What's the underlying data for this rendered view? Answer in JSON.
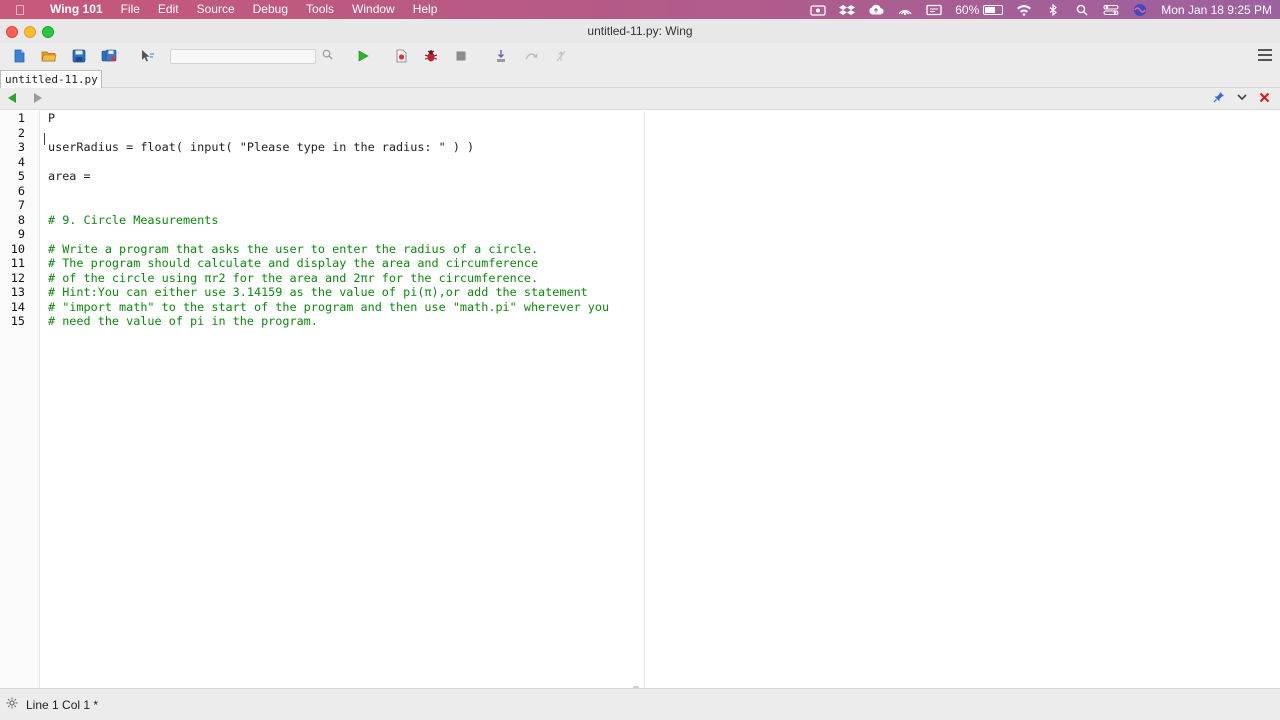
{
  "menubar": {
    "app_name": "Wing 101",
    "items": [
      "File",
      "Edit",
      "Source",
      "Debug",
      "Tools",
      "Window",
      "Help"
    ],
    "battery_percent": "60%",
    "battery_level": 0.6,
    "datetime": "Mon Jan 18  9:25 PM"
  },
  "window": {
    "title": "untitled-11.py: Wing"
  },
  "toolbar": {
    "search_value": "",
    "icons": [
      "new-file-icon",
      "open-folder-icon",
      "save-icon",
      "save-all-icon",
      "select-pointer-icon",
      "search-icon",
      "run-icon",
      "breakpoint-icon",
      "debug-bug-icon",
      "stop-icon",
      "step-into-icon",
      "step-over-icon",
      "step-out-icon",
      "menu-icon"
    ]
  },
  "tab": {
    "filename": "untitled-11.py"
  },
  "editor": {
    "lines": [
      {
        "num": "1",
        "text": "P",
        "kind": "code"
      },
      {
        "num": "2",
        "text": "",
        "kind": "code"
      },
      {
        "num": "3",
        "text": "userRadius = float( input( \"Please type in the radius: \" ) )",
        "kind": "code"
      },
      {
        "num": "4",
        "text": "",
        "kind": "code"
      },
      {
        "num": "5",
        "text": "area =",
        "kind": "code"
      },
      {
        "num": "6",
        "text": "",
        "kind": "code"
      },
      {
        "num": "7",
        "text": "",
        "kind": "code"
      },
      {
        "num": "8",
        "text": "# 9. Circle Measurements",
        "kind": "comment"
      },
      {
        "num": "9",
        "text": "",
        "kind": "code"
      },
      {
        "num": "10",
        "text": "# Write a program that asks the user to enter the radius of a circle.",
        "kind": "comment"
      },
      {
        "num": "11",
        "text": "# The program should calculate and display the area and circumference",
        "kind": "comment"
      },
      {
        "num": "12",
        "text": "# of the circle using πr2 for the area and 2πr for the circumference.",
        "kind": "comment"
      },
      {
        "num": "13",
        "text": "# Hint:You can either use 3.14159 as the value of pi(π),or add the statement",
        "kind": "comment"
      },
      {
        "num": "14",
        "text": "# \"import math\" to the start of the program and then use \"math.pi\" wherever you",
        "kind": "comment"
      },
      {
        "num": "15",
        "text": "# need the value of pi in the program.",
        "kind": "comment"
      }
    ]
  },
  "status": {
    "position_text": "Line 1 Col 1 *"
  },
  "colors": {
    "comment": "#0a8a0a",
    "nav_back": "#2aa52a",
    "close_x": "#d9221c"
  }
}
